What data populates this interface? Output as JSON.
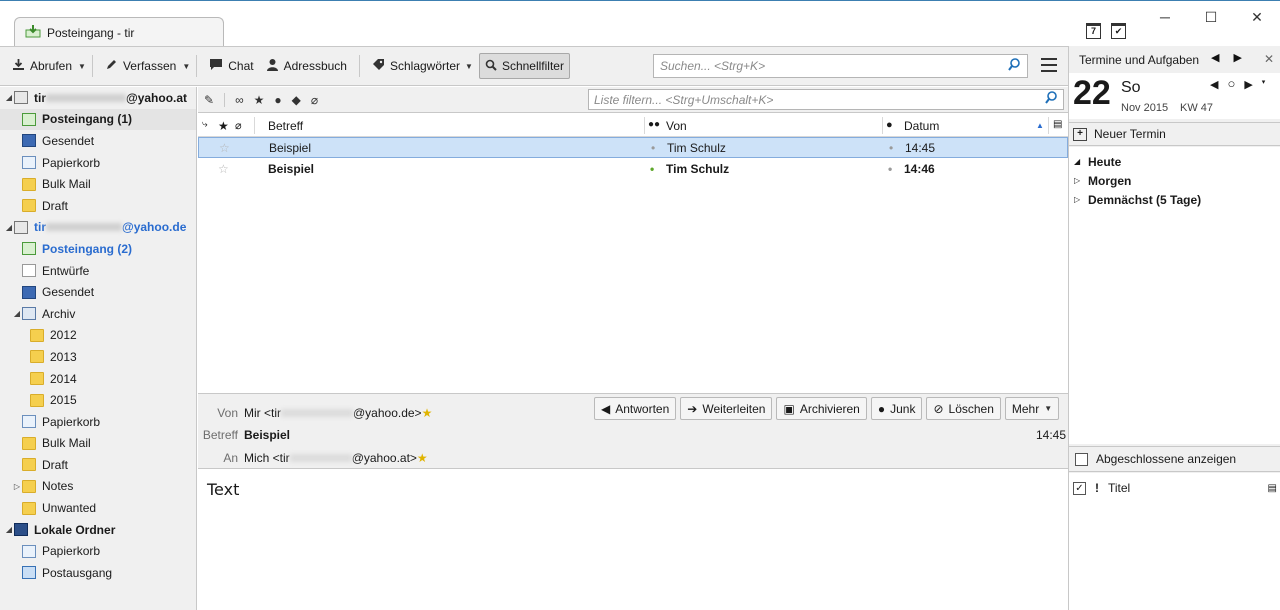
{
  "window": {
    "tab_title": "Posteingang - tir",
    "controls": {
      "minimize": "─",
      "maximize": "☐",
      "close": "✕"
    },
    "top_icons": {
      "calendar_day": "7",
      "tasks": "✔"
    }
  },
  "toolbar": {
    "get_mail": "Abrufen",
    "write": "Verfassen",
    "chat": "Chat",
    "address_book": "Adressbuch",
    "tags": "Schlagwörter",
    "quick_filter": "Schnellfilter",
    "search_placeholder": "Suchen... <Strg+K>"
  },
  "folders": [
    {
      "label": "tir",
      "suffix": "@yahoo.at",
      "type": "acct",
      "level": 0,
      "twisty": "◢",
      "bold": true
    },
    {
      "label": "Posteingang (1)",
      "type": "inbox",
      "level": 1,
      "bold": true,
      "selected": true
    },
    {
      "label": "Gesendet",
      "type": "sent",
      "level": 1
    },
    {
      "label": "Papierkorb",
      "type": "trash",
      "level": 1
    },
    {
      "label": "Bulk Mail",
      "type": "folder",
      "level": 1
    },
    {
      "label": "Draft",
      "type": "folder",
      "level": 1
    },
    {
      "label": "tir",
      "suffix": "@yahoo.de",
      "type": "acct",
      "level": 0,
      "twisty": "◢",
      "bold": true,
      "blue": true
    },
    {
      "label": "Posteingang (2)",
      "type": "inbox",
      "level": 1,
      "bold": true,
      "blue": true
    },
    {
      "label": "Entwürfe",
      "type": "draft-doc",
      "level": 1
    },
    {
      "label": "Gesendet",
      "type": "sent",
      "level": 1
    },
    {
      "label": "Archiv",
      "type": "archive",
      "level": 1,
      "twisty": "◢"
    },
    {
      "label": "2012",
      "type": "folder",
      "level": 2
    },
    {
      "label": "2013",
      "type": "folder",
      "level": 2
    },
    {
      "label": "2014",
      "type": "folder",
      "level": 2
    },
    {
      "label": "2015",
      "type": "folder",
      "level": 2
    },
    {
      "label": "Papierkorb",
      "type": "trash",
      "level": 1
    },
    {
      "label": "Bulk Mail",
      "type": "folder",
      "level": 1
    },
    {
      "label": "Draft",
      "type": "folder",
      "level": 1
    },
    {
      "label": "Notes",
      "type": "folder",
      "level": 1,
      "twisty": "▷"
    },
    {
      "label": "Unwanted",
      "type": "folder",
      "level": 1
    },
    {
      "label": "Lokale Ordner",
      "type": "pc",
      "level": 0,
      "twisty": "◢",
      "bold": true
    },
    {
      "label": "Papierkorb",
      "type": "trash",
      "level": 1
    },
    {
      "label": "Postausgang",
      "type": "outbox",
      "level": 1
    }
  ],
  "filter": {
    "placeholder": "Liste filtern... <Strg+Umschalt+K>"
  },
  "columns": {
    "subject": "Betreff",
    "from": "Von",
    "date": "Datum"
  },
  "messages": [
    {
      "subject": "Beispiel",
      "from": "Tim Schulz",
      "date": "14:45",
      "selected": true,
      "unread": false
    },
    {
      "subject": "Beispiel",
      "from": "Tim Schulz",
      "date": "14:46",
      "selected": false,
      "unread": true
    }
  ],
  "preview": {
    "from_label": "Von",
    "from_value_a": "Mir <tir",
    "from_value_b": "@yahoo.de>",
    "subject_label": "Betreff",
    "subject_value": "Beispiel",
    "to_label": "An",
    "to_value_a": "Mich <tir",
    "to_value_b": "@yahoo.at>",
    "time": "14:45",
    "body": "Text",
    "actions": {
      "reply": "Antworten",
      "forward": "Weiterleiten",
      "archive": "Archivieren",
      "junk": "Junk",
      "delete": "Löschen",
      "more": "Mehr"
    }
  },
  "calendar": {
    "title": "Termine und Aufgaben",
    "day_number": "22",
    "day_name": "So",
    "month_year": "Nov 2015",
    "week": "KW 47",
    "new_event": "Neuer Termin",
    "groups": [
      "Heute",
      "Morgen",
      "Demnächst (5 Tage)"
    ],
    "show_completed": "Abgeschlossene anzeigen",
    "task_title_col": "Titel"
  }
}
